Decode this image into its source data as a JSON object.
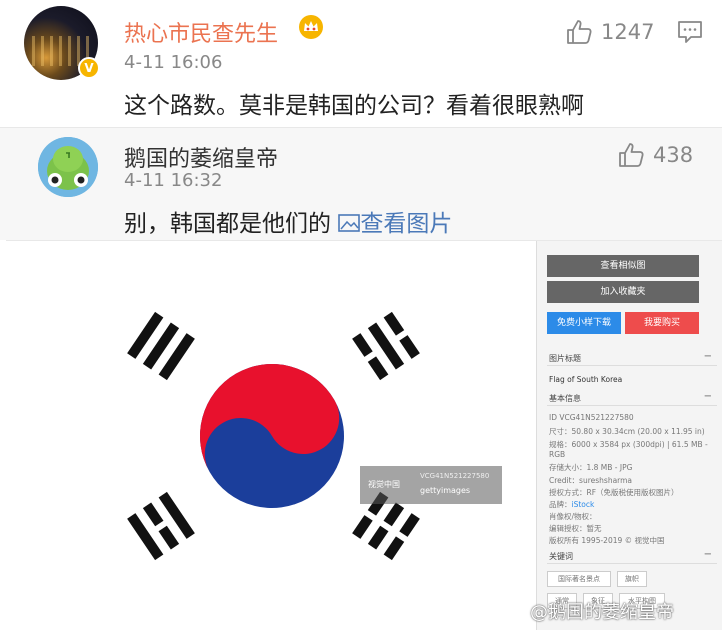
{
  "comments": [
    {
      "username": "热心市民查先生",
      "timestamp": "4-11 16:06",
      "text": "这个路数。莫非是韩国的公司？看着很眼熟啊",
      "likes": "1247",
      "verified": true
    },
    {
      "username": "鹅国的萎缩皇帝",
      "timestamp": "4-11 16:32",
      "text": "别，韩国都是他们的",
      "link_text": "查看图片",
      "likes": "438"
    }
  ],
  "stock_panel": {
    "btn_similar": "查看相似图",
    "btn_favorite": "加入收藏夹",
    "btn_free_download": "免费小样下载",
    "btn_buy": "我要购买",
    "title_label": "图片标题",
    "title_value": "Flag of South Korea",
    "basic_info_label": "基本信息",
    "id_line": "ID   VCG41N521227580",
    "size_line": "尺寸：50.80 x 30.34cm (20.00 x 11.95 in)",
    "pixels_line": "规格：6000 x 3584 px (300dpi) | 61.5 MB -",
    "rgb_line": "RGB",
    "file_line": "存储大小：1.8 MB - JPG",
    "credit_line": "Credit：sureshsharma",
    "license_line": "授权方式：RF（免版税使用版权图片）",
    "brand_label": "品牌：",
    "brand_value": "iStock",
    "portrait_line": "肖像权/物权：",
    "release_line": "编辑授权：暂无",
    "copyright_line": "版权所有 1995-2019 © 视觉中国",
    "keywords_label": "关键词",
    "keywords": [
      "国际著名景点",
      "旗帜",
      "通常",
      "象征",
      "水平构图"
    ],
    "watermark_code": "VCG41N521227580",
    "watermark_brand": "gettyimages",
    "watermark_vcg": "视觉中国"
  },
  "corner_watermark": "@鹅国的萎缩皇帝",
  "colors": {
    "username_accent": "#eb7350",
    "link": "#4b79b8",
    "flag_red": "#e8112d",
    "flag_blue": "#1b3e9b"
  }
}
